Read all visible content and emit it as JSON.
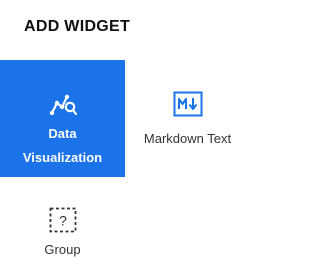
{
  "panel": {
    "title": "ADD WIDGET"
  },
  "widgets": [
    {
      "label_line1": "Data",
      "label_line2": "Visualization",
      "icon": "data-visualization-icon",
      "selected": true
    },
    {
      "label": "Markdown Text",
      "icon": "markdown-icon",
      "selected": false
    },
    {
      "label": "Group",
      "icon": "group-icon",
      "selected": false
    }
  ],
  "colors": {
    "accent": "#1a73e8",
    "selected_text": "#ffffff",
    "icon_blue": "#1a73e8",
    "text": "#333333"
  }
}
